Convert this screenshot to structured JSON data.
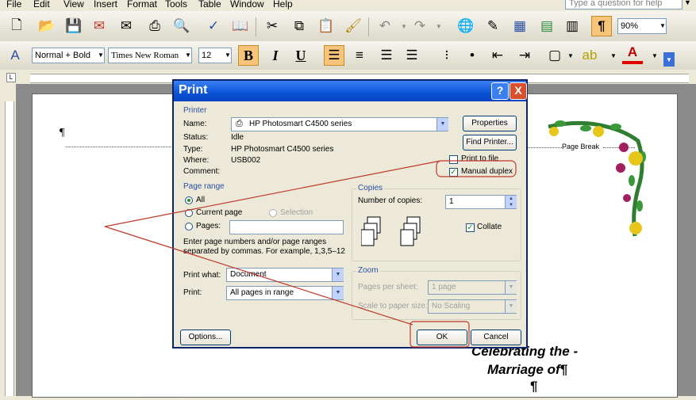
{
  "menubar": {
    "items": [
      "File",
      "Edit",
      "View",
      "Insert",
      "Format",
      "Tools",
      "Table",
      "Window",
      "Help"
    ],
    "ask_placeholder": "Type a question for help"
  },
  "toolbar": {
    "zoom": "90%",
    "pilcrow": "¶"
  },
  "format_toolbar": {
    "style": "Normal + Bold",
    "font": "Times New Roman",
    "size": "12",
    "bold": "B",
    "italic": "I",
    "underline": "U",
    "font_color_letter": "A"
  },
  "document": {
    "pilcrow": "¶",
    "page_break": "Page Break",
    "heading_line1": "Celebrating the -",
    "heading_line2": "Marriage of¶",
    "heading_pilcrow": "¶",
    "bottom_text": "..................."
  },
  "dialog": {
    "title": "Print",
    "help": "?",
    "close": "X",
    "printer": {
      "group": "Printer",
      "name_label": "Name:",
      "name_value": "HP Photosmart C4500 series",
      "status_label": "Status:",
      "status_value": "Idle",
      "type_label": "Type:",
      "type_value": "HP Photosmart C4500 series",
      "where_label": "Where:",
      "where_value": "USB002",
      "comment_label": "Comment:",
      "properties": "Properties",
      "find_printer": "Find Printer...",
      "print_to_file": "Print to file",
      "manual_duplex": "Manual duplex"
    },
    "page_range": {
      "group": "Page range",
      "all": "All",
      "current_page": "Current page",
      "selection": "Selection",
      "pages": "Pages:",
      "hint_line1": "Enter page numbers and/or page ranges",
      "hint_line2": "separated by commas.  For example, 1,3,5–12"
    },
    "copies": {
      "group": "Copies",
      "number_label": "Number of copies:",
      "number_value": "1",
      "collate": "Collate"
    },
    "print_what_label": "Print what:",
    "print_what_value": "Document",
    "print_label": "Print:",
    "print_value": "All pages in range",
    "zoom": {
      "group": "Zoom",
      "pages_per_sheet_label": "Pages per sheet:",
      "pages_per_sheet_value": "1 page",
      "scale_label": "Scale to paper size:",
      "scale_value": "No Scaling"
    },
    "options": "Options...",
    "ok": "OK",
    "cancel": "Cancel"
  },
  "colors": {
    "annotation": "#c0392b",
    "title_bar": "#0a53d6"
  }
}
